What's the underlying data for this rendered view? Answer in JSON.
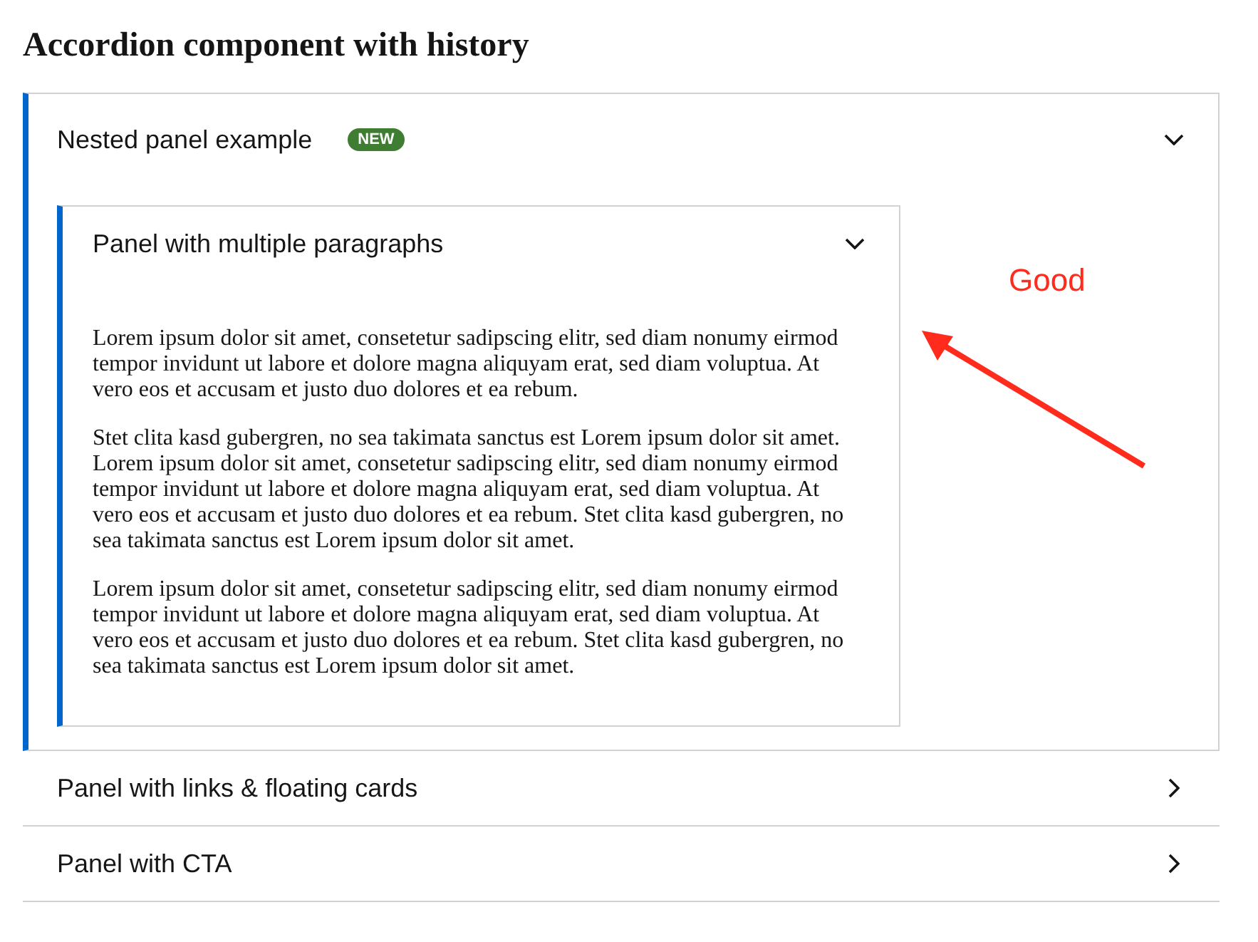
{
  "title": "Accordion component with history",
  "accordion": [
    {
      "title": "Nested panel example",
      "badge": "NEW",
      "expanded": true,
      "children": [
        {
          "title": "Panel with multiple paragraphs",
          "expanded": true,
          "paragraphs": [
            "Lorem ipsum dolor sit amet, consetetur sadipscing elitr, sed diam nonumy eirmod tempor invidunt ut labore et dolore magna aliquyam erat, sed diam voluptua. At vero eos et accusam et justo duo dolores et ea rebum.",
            "Stet clita kasd gubergren, no sea takimata sanctus est Lorem ipsum dolor sit amet. Lorem ipsum dolor sit amet, consetetur sadipscing elitr, sed diam nonumy eirmod tempor invidunt ut labore et dolore magna aliquyam erat, sed diam voluptua. At vero eos et accusam et justo duo dolores et ea rebum. Stet clita kasd gubergren, no sea takimata sanctus est Lorem ipsum dolor sit amet.",
            "Lorem ipsum dolor sit amet, consetetur sadipscing elitr, sed diam nonumy eirmod tempor invidunt ut labore et dolore magna aliquyam erat, sed diam voluptua. At vero eos et accusam et justo duo dolores et ea rebum. Stet clita kasd gubergren, no sea takimata sanctus est Lorem ipsum dolor sit amet."
          ]
        }
      ]
    },
    {
      "title": "Panel with links & floating cards",
      "expanded": false
    },
    {
      "title": "Panel with CTA",
      "expanded": false
    }
  ],
  "annotation": {
    "text": "Good"
  }
}
